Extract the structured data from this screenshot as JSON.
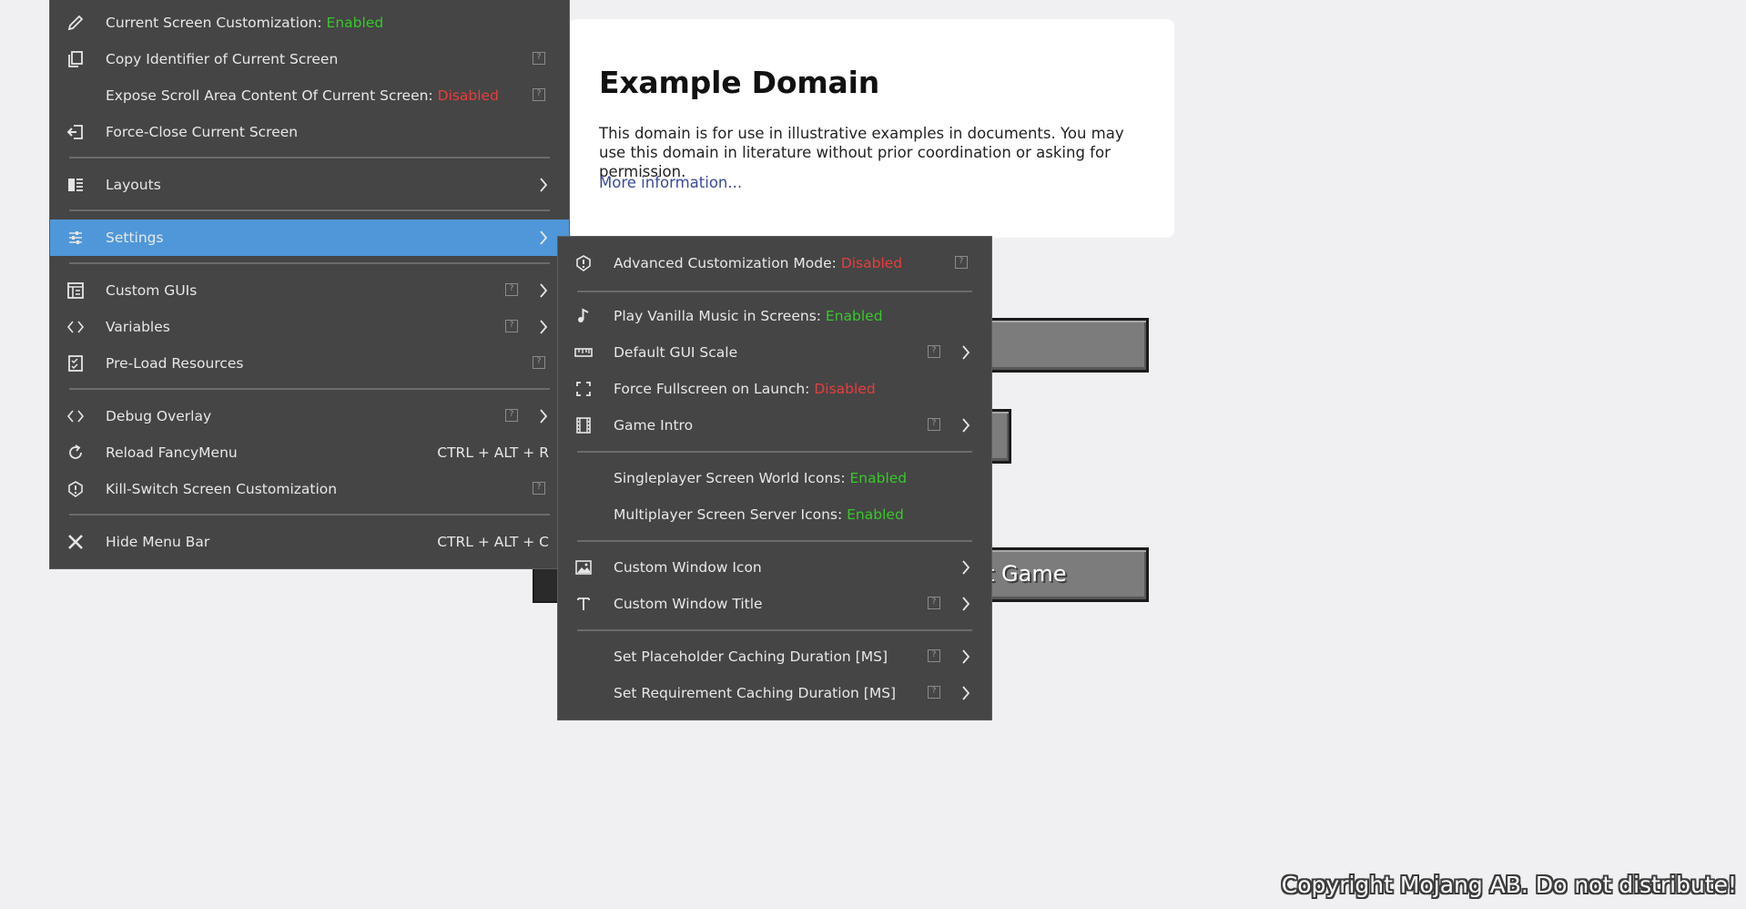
{
  "web_page": {
    "title": "Example Domain",
    "body_text": "This domain is for use in illustrative examples in documents. You may use this domain in literature without prior coordination or asking for permission.",
    "link_text": "More information..."
  },
  "game_buttons": {
    "quit_label_visible": "t Game"
  },
  "copyright": "Copyright Mojang AB. Do not distribute!",
  "colors": {
    "menu_bg": "#454545",
    "highlight": "#4f97d8",
    "enabled": "#36c92a",
    "disabled": "#ea3c3c"
  },
  "main_menu": {
    "items": [
      {
        "label": "Current Screen Customization: ",
        "state": "Enabled",
        "icon": "pencil-icon"
      },
      {
        "label": "Copy Identifier of Current Screen",
        "icon": "copy-icon"
      },
      {
        "label": "Expose Scroll Area Content Of Current Screen: ",
        "state": "Disabled"
      },
      {
        "label": "Force-Close Current Screen",
        "icon": "exit-icon"
      },
      {
        "label": "Layouts",
        "icon": "layouts-icon"
      },
      {
        "label": "Settings",
        "icon": "sliders-icon"
      },
      {
        "label": "Custom GUIs",
        "icon": "gui-icon"
      },
      {
        "label": "Variables",
        "icon": "code-icon"
      },
      {
        "label": "Pre-Load Resources",
        "icon": "checklist-icon"
      },
      {
        "label": "Debug Overlay",
        "icon": "code-icon"
      },
      {
        "label": "Reload FancyMenu",
        "shortcut": "CTRL + ALT + R",
        "icon": "reload-icon"
      },
      {
        "label": "Kill-Switch Screen Customization",
        "icon": "alert-icon"
      },
      {
        "label": "Hide Menu Bar",
        "shortcut": "CTRL + ALT + C",
        "icon": "close-icon"
      }
    ]
  },
  "settings_menu": {
    "items": [
      {
        "label": "Advanced Customization Mode: ",
        "state": "Disabled",
        "icon": "alert-icon"
      },
      {
        "label": "Play Vanilla Music in Screens: ",
        "state": "Enabled",
        "icon": "music-note-icon"
      },
      {
        "label": "Default GUI Scale",
        "icon": "ruler-icon"
      },
      {
        "label": "Force Fullscreen on Launch: ",
        "state": "Disabled",
        "icon": "fullscreen-icon"
      },
      {
        "label": "Game Intro",
        "icon": "film-icon"
      },
      {
        "label": "Singleplayer Screen World Icons: ",
        "state": "Enabled"
      },
      {
        "label": "Multiplayer Screen Server Icons: ",
        "state": "Enabled"
      },
      {
        "label": "Custom Window Icon",
        "icon": "image-icon"
      },
      {
        "label": "Custom Window Title",
        "icon": "text-icon"
      },
      {
        "label": "Set Placeholder Caching Duration [MS]"
      },
      {
        "label": "Set Requirement Caching Duration [MS]"
      }
    ]
  }
}
